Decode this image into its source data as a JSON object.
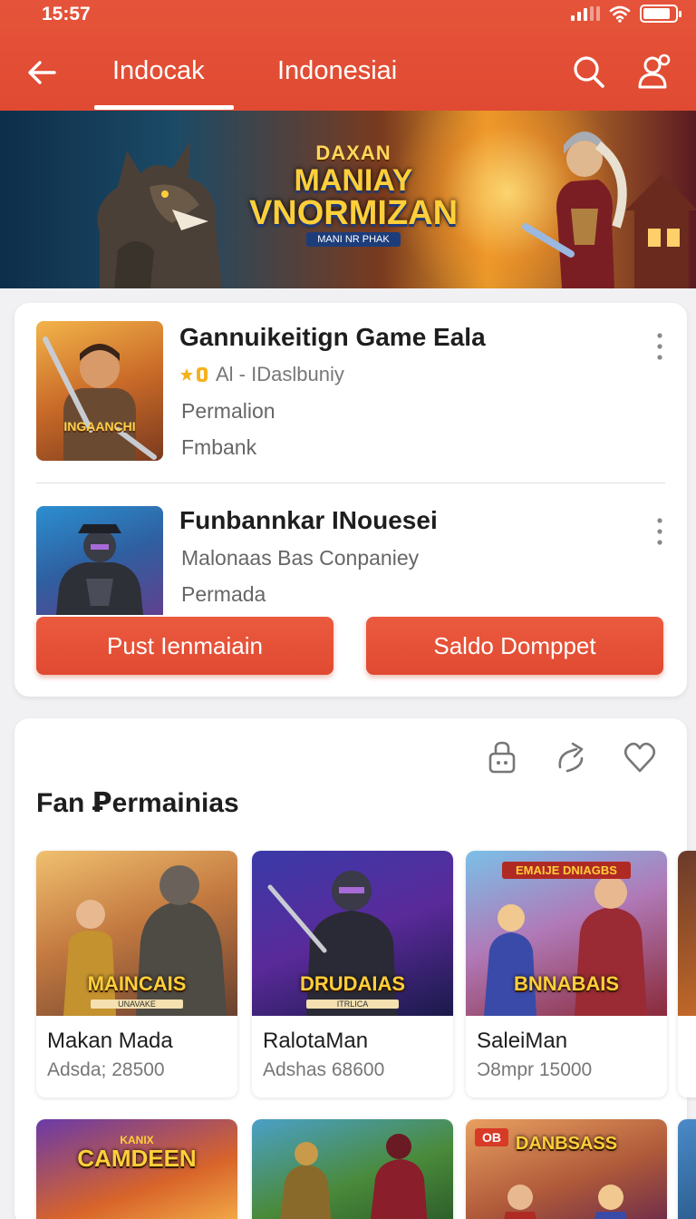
{
  "status_bar": {
    "time": "15:57",
    "battery_level": 0.85
  },
  "header": {
    "tabs": [
      {
        "label": "Indocak",
        "active": true
      },
      {
        "label": "Indonesiai",
        "active": false
      }
    ],
    "accent_color": "#e04a32"
  },
  "banner": {
    "logo_line1": "DAXAN",
    "logo_line2": "MANIAY",
    "logo_line3": "VNORMIZAN",
    "logo_tagline": "MANI NR PHAK"
  },
  "apps": [
    {
      "thumb_caption": "INGAANCHI",
      "title": "Gannuikeitign Game Eala",
      "meta": "Al - IDaslbuniy",
      "line1": "Permalion",
      "line2": "Fmbank"
    },
    {
      "title": "Funbannkar INouesei",
      "line1": "Malonaas Bas Conpaniey",
      "line2": "Permada"
    }
  ],
  "actions": {
    "primary_label": "Pust Ienmaiain",
    "secondary_label": "Saldo Domppet"
  },
  "section": {
    "title": "Fan Ꝑermainias",
    "tools": [
      "lock-icon",
      "share-icon",
      "heart-icon"
    ]
  },
  "games": [
    {
      "art_title": "MAINCAIS",
      "art_sub": "UNAVAKE",
      "name": "Makan Mada",
      "sub": "Adsda; 28500"
    },
    {
      "art_title": "DRUDAIAS",
      "art_sub": "ITRLICA",
      "name": "RalotaMan",
      "sub": "Adshas 68600"
    },
    {
      "art_top": "EMAIJE DNIAGBS",
      "art_title": "BNNABAIS",
      "name": "SaleiMan",
      "sub": "Ɔ8mpr 15000"
    },
    {
      "art_title": "CAMDEEN",
      "art_top": "KANIX"
    },
    {},
    {
      "badge": "OB",
      "art_title": "DANBSASS"
    }
  ]
}
